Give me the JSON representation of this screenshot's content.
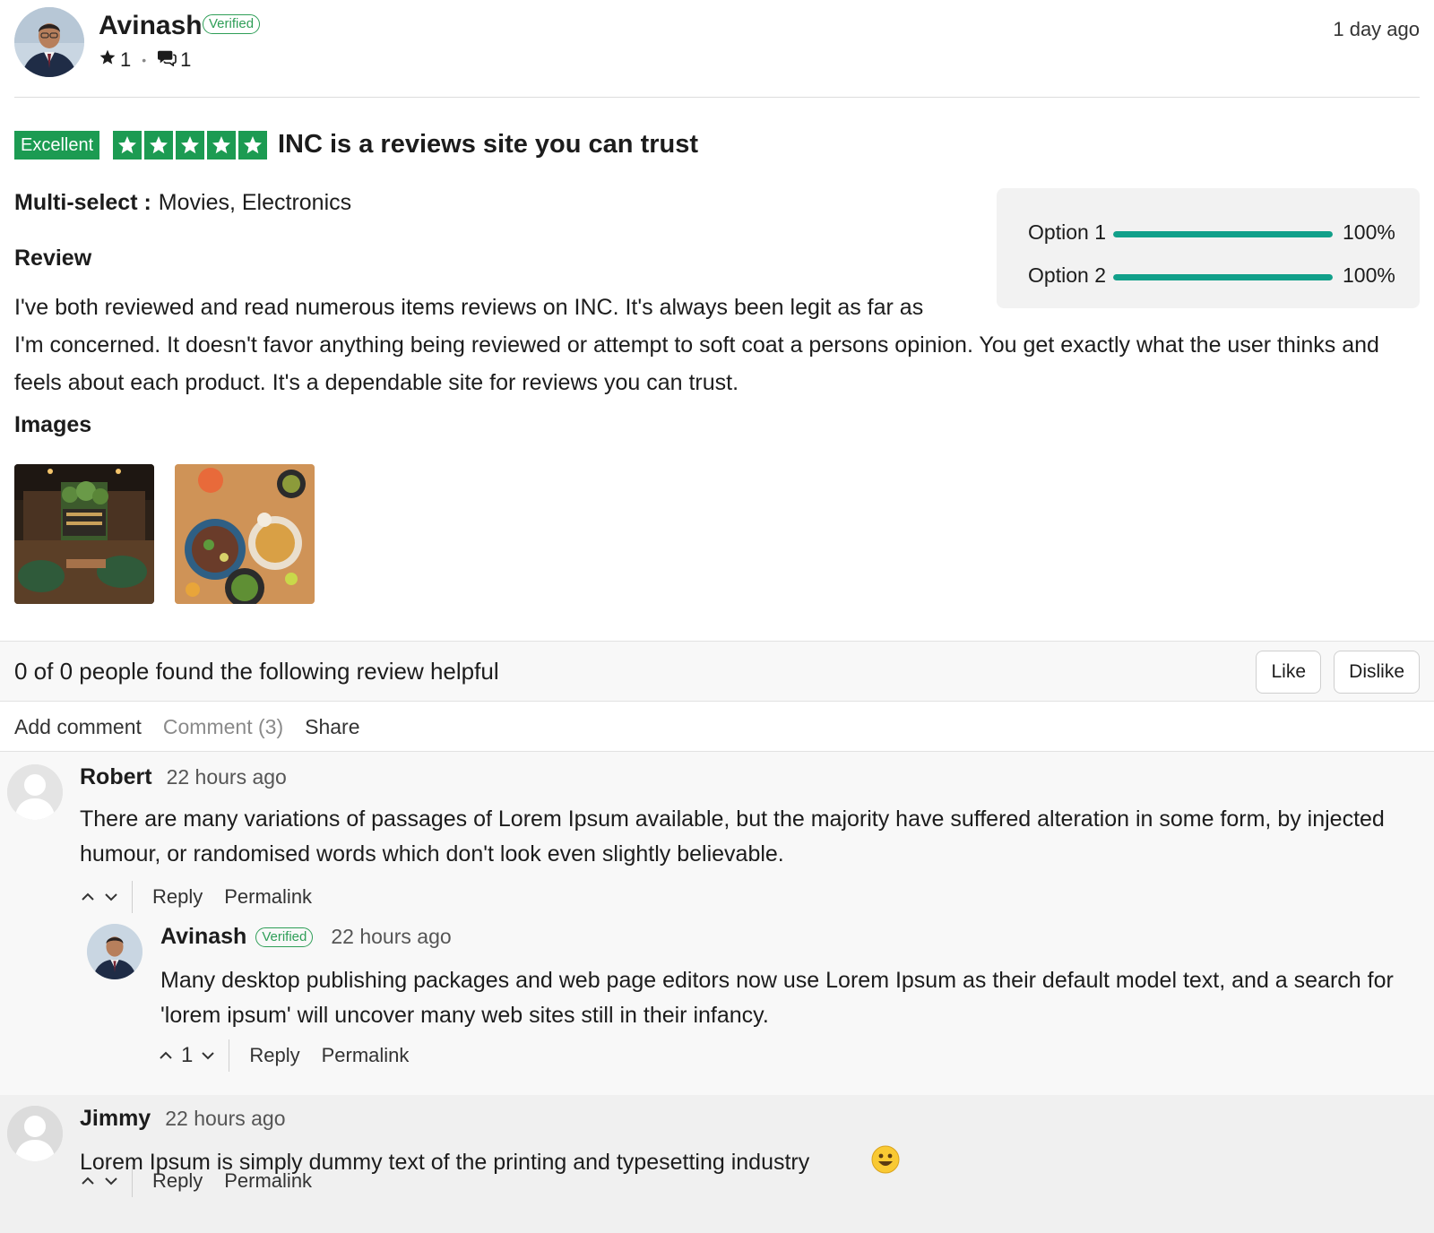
{
  "review": {
    "author": "Avinash",
    "verified_label": "Verified",
    "stars_count": "1",
    "comments_count": "1",
    "time": "1 day ago",
    "rating_label": "Excellent",
    "rating_value": 5,
    "title": "INC is a reviews site you can trust",
    "multi_select_label": "Multi-select :",
    "multi_select_value": "Movies, Electronics",
    "review_heading": "Review",
    "body": "I've both reviewed and read numerous items reviews on INC. It's always been legit as far as I'm concerned. It doesn't favor anything being reviewed or attempt to soft coat a persons opinion. You get exactly what the user thinks and feels about each product. It's a dependable site for reviews you can trust.",
    "images_heading": "Images",
    "options": [
      {
        "label": "Option 1",
        "percent": "100%",
        "fraction": 1.0
      },
      {
        "label": "Option 2",
        "percent": "100%",
        "fraction": 1.0
      }
    ]
  },
  "helpful": {
    "text": "0 of 0 people found the following review helpful",
    "like_label": "Like",
    "dislike_label": "Dislike"
  },
  "tabs": {
    "add_comment": "Add comment",
    "comment": "Comment (3)",
    "share": "Share"
  },
  "comments": [
    {
      "name": "Robert",
      "time": "22 hours ago",
      "text": "There are many variations of passages of Lorem Ipsum available, but the majority have suffered alteration in some form, by injected humour, or randomised words which don't look even slightly believable.",
      "reply_label": "Reply",
      "permalink_label": "Permalink"
    },
    {
      "name": "Avinash",
      "verified_label": "Verified",
      "time": "22 hours ago",
      "text": "Many desktop publishing packages and web page editors now use Lorem Ipsum as their default model text, and a search for 'lorem ipsum' will uncover many web sites still in their infancy.",
      "vote_count": "1",
      "reply_label": "Reply",
      "permalink_label": "Permalink"
    },
    {
      "name": "Jimmy",
      "time": "22 hours ago",
      "text": "Lorem Ipsum is simply dummy text of the printing and typesetting industry",
      "emoji": "😀",
      "reply_label": "Reply",
      "permalink_label": "Permalink"
    }
  ],
  "colors": {
    "brand_green": "#1c9b52",
    "progress_teal": "#11a08a",
    "verified_green": "#2e9e57"
  },
  "icons": [
    "star-icon",
    "comment-icon",
    "chevron-up-icon",
    "chevron-down-icon",
    "smiley-emoji-icon"
  ]
}
